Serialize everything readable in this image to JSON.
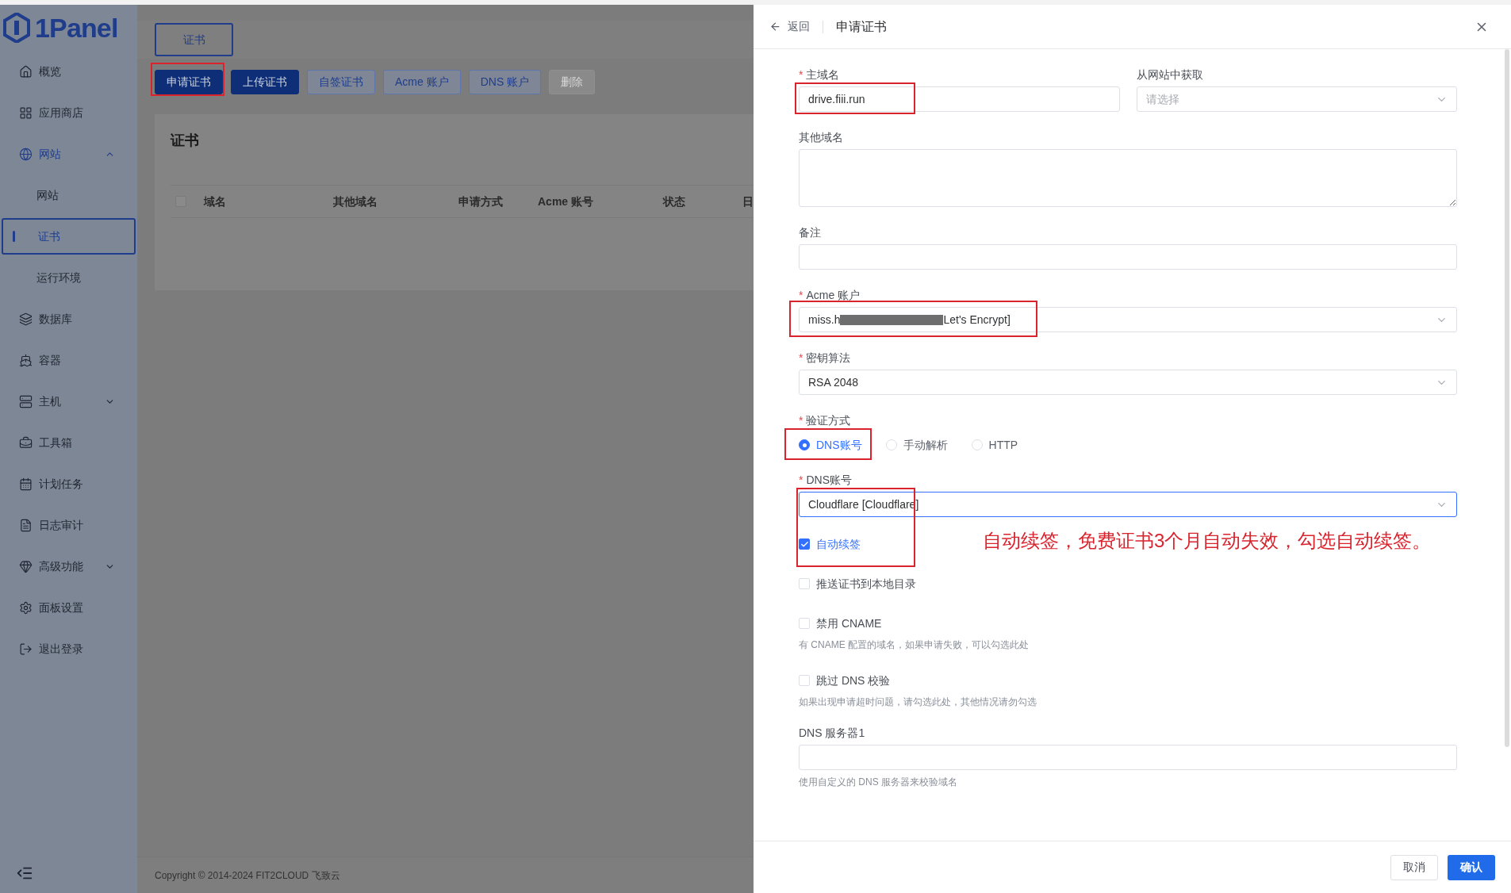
{
  "sidebar": {
    "logo": "1Panel",
    "items": [
      {
        "label": "概览",
        "selected": false
      },
      {
        "label": "应用商店",
        "selected": false
      },
      {
        "label": "网站",
        "selected": true,
        "expanded": true,
        "children": [
          {
            "label": "网站",
            "selected": false
          },
          {
            "label": "证书",
            "selected": true
          },
          {
            "label": "运行环境",
            "selected": false
          }
        ]
      },
      {
        "label": "数据库",
        "selected": false
      },
      {
        "label": "容器",
        "selected": false
      },
      {
        "label": "主机",
        "selected": false,
        "expanded": false
      },
      {
        "label": "工具箱",
        "selected": false
      },
      {
        "label": "计划任务",
        "selected": false
      },
      {
        "label": "日志审计",
        "selected": false
      },
      {
        "label": "高级功能",
        "selected": false,
        "expanded": false
      },
      {
        "label": "面板设置",
        "selected": false
      },
      {
        "label": "退出登录",
        "selected": false
      }
    ]
  },
  "tabs": [
    {
      "label": "证书",
      "selected": true
    }
  ],
  "toolbar": [
    {
      "label": "申请证书",
      "kind": "primary",
      "highlighted": true
    },
    {
      "label": "上传证书",
      "kind": "primary"
    },
    {
      "label": "自签证书",
      "kind": "outline"
    },
    {
      "label": "Acme 账户",
      "kind": "outline"
    },
    {
      "label": "DNS 账户",
      "kind": "outline"
    },
    {
      "label": "删除",
      "kind": "disabled"
    }
  ],
  "card": {
    "title": "证书",
    "table": {
      "select_all": {
        "checked": false
      },
      "columns": [
        "域名",
        "其他域名",
        "申请方式",
        "Acme 账号",
        "状态",
        "日"
      ]
    }
  },
  "footer": "Copyright © 2014-2024 FIT2CLOUD 飞致云",
  "drawer": {
    "back": "返回",
    "title": "申请证书",
    "fields": [
      {
        "kind": "pair",
        "items": [
          {
            "kind": "input",
            "label": "主域名",
            "required_mark": "*",
            "value": "drive.fiii.run",
            "highlighted": true
          },
          {
            "kind": "select",
            "label": "从网站中获取",
            "placeholder": "请选择"
          }
        ]
      },
      {
        "kind": "textarea",
        "label": "其他域名"
      },
      {
        "kind": "input",
        "label": "备注"
      },
      {
        "kind": "redacted_select",
        "label": "Acme 账户",
        "required_mark": "*",
        "value_start": "miss.h",
        "value_end": "Let's Encrypt]",
        "highlighted": true
      },
      {
        "kind": "select",
        "label": "密钥算法",
        "required_mark": "*",
        "value": "RSA 2048"
      },
      {
        "kind": "radio",
        "label": "验证方式",
        "required_mark": "*",
        "options": [
          {
            "label": "DNS账号",
            "selected": true,
            "highlighted": true
          },
          {
            "label": "手动解析",
            "selected": false
          },
          {
            "label": "HTTP",
            "selected": false
          }
        ]
      },
      {
        "kind": "select",
        "label": "DNS账号",
        "required_mark": "*",
        "value": "Cloudflare [Cloudflare]",
        "focused": true,
        "highlighted": true
      },
      {
        "kind": "checkbox",
        "label": "自动续签",
        "checked": true,
        "note": "自动续签，免费证书3个月自动失效，勾选自动续签。"
      },
      {
        "kind": "checkbox",
        "label": "推送证书到本地目录",
        "checked": false
      },
      {
        "kind": "checkbox",
        "label": "禁用 CNAME",
        "checked": false,
        "hint": "有 CNAME 配置的域名，如果申请失败，可以勾选此处"
      },
      {
        "kind": "checkbox",
        "label": "跳过 DNS 校验",
        "checked": false,
        "hint": "如果出现申请超时问题，请勾选此处，其他情况请勿勾选"
      },
      {
        "kind": "input",
        "label": "DNS 服务器1",
        "hint": "使用自定义的 DNS 服务器来校验域名"
      }
    ],
    "buttons": [
      {
        "label": "取消",
        "kind": "default"
      },
      {
        "label": "确认",
        "kind": "primary"
      }
    ]
  }
}
